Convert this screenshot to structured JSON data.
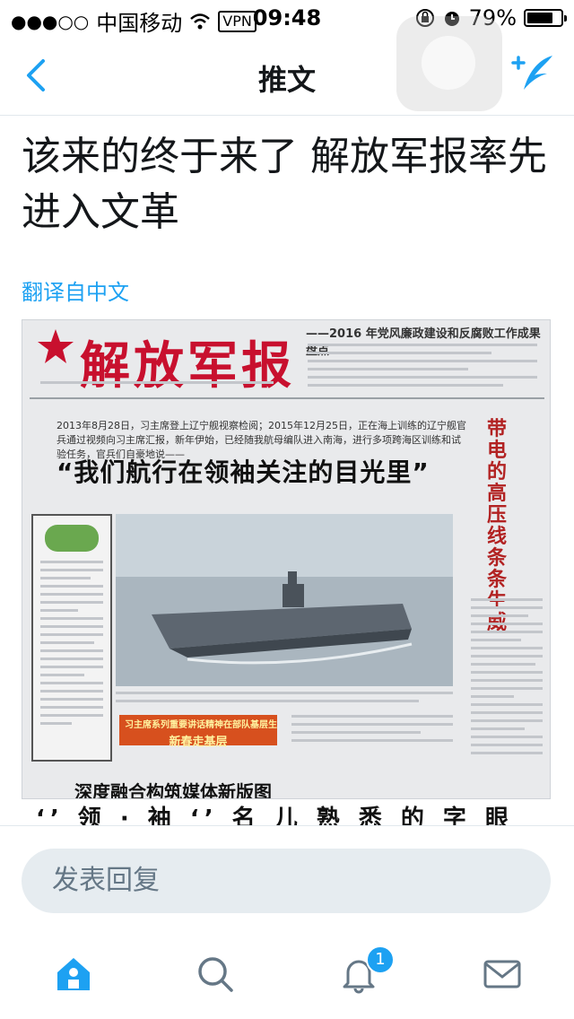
{
  "status_bar": {
    "signal": "●●●○○",
    "carrier": "中国移动",
    "vpn_label": "VPN",
    "time": "09:48",
    "battery_percent": "79%",
    "battery_level": 0.79
  },
  "nav": {
    "title": "推文",
    "back_icon": "chevron-left-icon",
    "compose_icon": "compose-tweet-icon"
  },
  "tweet": {
    "text": "该来的终于来了 解放军报率先进入文革",
    "translate_label": "翻译自中文"
  },
  "newspaper": {
    "masthead": "解放军报",
    "masthead_subtitle": "——2016 年党风廉政建设和反腐败工作成果盘点",
    "intro_line": "2013年8月28日，习主席登上辽宁舰视察检阅；2015年12月25日，正在海上训练的辽宁舰官兵通过视频向习主席汇报，新年伊始，已经随我航母编队进入南海，进行多项跨海区训练和试验任务，官兵们自豪地说——",
    "headline": "“我们航行在领袖关注的目光里”",
    "side_headline": "带电的高压线条条生威",
    "red_banner_line1": "习主席系列重要讲话精神在部队基层生根",
    "red_banner_line2": "新春走基层",
    "bottom_headline": "深度融合构筑媒体新版图",
    "cut_line": "‘’ 领 · 袖 ‘’ 名 儿 熟 悉 的 字 眼"
  },
  "reply": {
    "placeholder": "发表回复"
  },
  "tabbar": {
    "items": [
      "home-icon",
      "search-icon",
      "notifications-icon",
      "messages-icon"
    ],
    "notification_badge": "1"
  },
  "colors": {
    "accent": "#1da1f2",
    "text": "#14171a",
    "muted": "#657786",
    "masthead_red": "#c8102e"
  }
}
